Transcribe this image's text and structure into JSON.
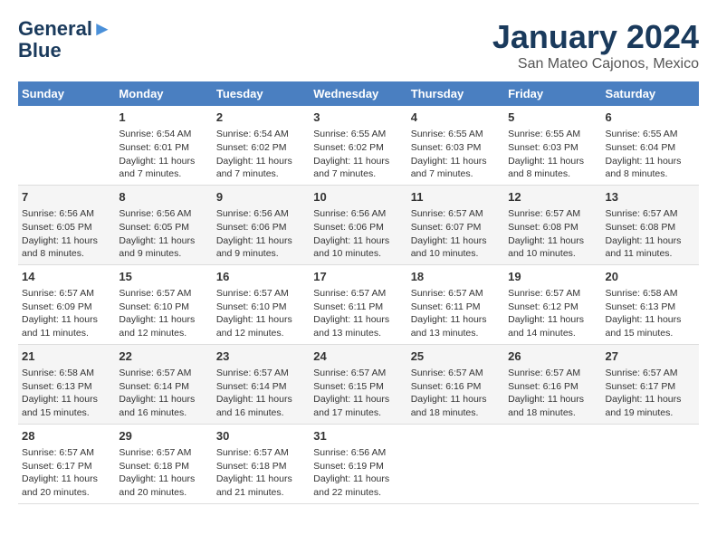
{
  "header": {
    "logo_line1": "General",
    "logo_line2": "Blue",
    "month": "January 2024",
    "location": "San Mateo Cajonos, Mexico"
  },
  "days_of_week": [
    "Sunday",
    "Monday",
    "Tuesday",
    "Wednesday",
    "Thursday",
    "Friday",
    "Saturday"
  ],
  "weeks": [
    [
      {
        "num": "",
        "info": ""
      },
      {
        "num": "1",
        "info": "Sunrise: 6:54 AM\nSunset: 6:01 PM\nDaylight: 11 hours\nand 7 minutes."
      },
      {
        "num": "2",
        "info": "Sunrise: 6:54 AM\nSunset: 6:02 PM\nDaylight: 11 hours\nand 7 minutes."
      },
      {
        "num": "3",
        "info": "Sunrise: 6:55 AM\nSunset: 6:02 PM\nDaylight: 11 hours\nand 7 minutes."
      },
      {
        "num": "4",
        "info": "Sunrise: 6:55 AM\nSunset: 6:03 PM\nDaylight: 11 hours\nand 7 minutes."
      },
      {
        "num": "5",
        "info": "Sunrise: 6:55 AM\nSunset: 6:03 PM\nDaylight: 11 hours\nand 8 minutes."
      },
      {
        "num": "6",
        "info": "Sunrise: 6:55 AM\nSunset: 6:04 PM\nDaylight: 11 hours\nand 8 minutes."
      }
    ],
    [
      {
        "num": "7",
        "info": "Sunrise: 6:56 AM\nSunset: 6:05 PM\nDaylight: 11 hours\nand 8 minutes."
      },
      {
        "num": "8",
        "info": "Sunrise: 6:56 AM\nSunset: 6:05 PM\nDaylight: 11 hours\nand 9 minutes."
      },
      {
        "num": "9",
        "info": "Sunrise: 6:56 AM\nSunset: 6:06 PM\nDaylight: 11 hours\nand 9 minutes."
      },
      {
        "num": "10",
        "info": "Sunrise: 6:56 AM\nSunset: 6:06 PM\nDaylight: 11 hours\nand 10 minutes."
      },
      {
        "num": "11",
        "info": "Sunrise: 6:57 AM\nSunset: 6:07 PM\nDaylight: 11 hours\nand 10 minutes."
      },
      {
        "num": "12",
        "info": "Sunrise: 6:57 AM\nSunset: 6:08 PM\nDaylight: 11 hours\nand 10 minutes."
      },
      {
        "num": "13",
        "info": "Sunrise: 6:57 AM\nSunset: 6:08 PM\nDaylight: 11 hours\nand 11 minutes."
      }
    ],
    [
      {
        "num": "14",
        "info": "Sunrise: 6:57 AM\nSunset: 6:09 PM\nDaylight: 11 hours\nand 11 minutes."
      },
      {
        "num": "15",
        "info": "Sunrise: 6:57 AM\nSunset: 6:10 PM\nDaylight: 11 hours\nand 12 minutes."
      },
      {
        "num": "16",
        "info": "Sunrise: 6:57 AM\nSunset: 6:10 PM\nDaylight: 11 hours\nand 12 minutes."
      },
      {
        "num": "17",
        "info": "Sunrise: 6:57 AM\nSunset: 6:11 PM\nDaylight: 11 hours\nand 13 minutes."
      },
      {
        "num": "18",
        "info": "Sunrise: 6:57 AM\nSunset: 6:11 PM\nDaylight: 11 hours\nand 13 minutes."
      },
      {
        "num": "19",
        "info": "Sunrise: 6:57 AM\nSunset: 6:12 PM\nDaylight: 11 hours\nand 14 minutes."
      },
      {
        "num": "20",
        "info": "Sunrise: 6:58 AM\nSunset: 6:13 PM\nDaylight: 11 hours\nand 15 minutes."
      }
    ],
    [
      {
        "num": "21",
        "info": "Sunrise: 6:58 AM\nSunset: 6:13 PM\nDaylight: 11 hours\nand 15 minutes."
      },
      {
        "num": "22",
        "info": "Sunrise: 6:57 AM\nSunset: 6:14 PM\nDaylight: 11 hours\nand 16 minutes."
      },
      {
        "num": "23",
        "info": "Sunrise: 6:57 AM\nSunset: 6:14 PM\nDaylight: 11 hours\nand 16 minutes."
      },
      {
        "num": "24",
        "info": "Sunrise: 6:57 AM\nSunset: 6:15 PM\nDaylight: 11 hours\nand 17 minutes."
      },
      {
        "num": "25",
        "info": "Sunrise: 6:57 AM\nSunset: 6:16 PM\nDaylight: 11 hours\nand 18 minutes."
      },
      {
        "num": "26",
        "info": "Sunrise: 6:57 AM\nSunset: 6:16 PM\nDaylight: 11 hours\nand 18 minutes."
      },
      {
        "num": "27",
        "info": "Sunrise: 6:57 AM\nSunset: 6:17 PM\nDaylight: 11 hours\nand 19 minutes."
      }
    ],
    [
      {
        "num": "28",
        "info": "Sunrise: 6:57 AM\nSunset: 6:17 PM\nDaylight: 11 hours\nand 20 minutes."
      },
      {
        "num": "29",
        "info": "Sunrise: 6:57 AM\nSunset: 6:18 PM\nDaylight: 11 hours\nand 20 minutes."
      },
      {
        "num": "30",
        "info": "Sunrise: 6:57 AM\nSunset: 6:18 PM\nDaylight: 11 hours\nand 21 minutes."
      },
      {
        "num": "31",
        "info": "Sunrise: 6:56 AM\nSunset: 6:19 PM\nDaylight: 11 hours\nand 22 minutes."
      },
      {
        "num": "",
        "info": ""
      },
      {
        "num": "",
        "info": ""
      },
      {
        "num": "",
        "info": ""
      }
    ]
  ]
}
